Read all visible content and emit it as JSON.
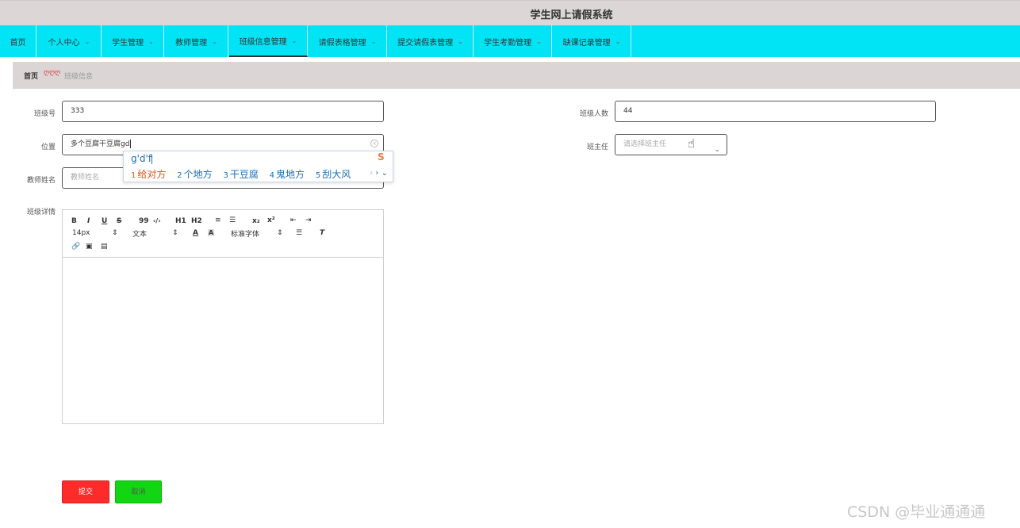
{
  "app": {
    "title": "学生网上请假系统"
  },
  "nav": {
    "items": [
      {
        "label": "首页"
      },
      {
        "label": "个人中心"
      },
      {
        "label": "学生管理"
      },
      {
        "label": "教师管理"
      },
      {
        "label": "班级信息管理"
      },
      {
        "label": "请假表格管理"
      },
      {
        "label": "提交请假表管理"
      },
      {
        "label": "学生考勤管理"
      },
      {
        "label": "缺课记录管理"
      }
    ],
    "active_index": 4,
    "chevron": "⌄"
  },
  "breadcrumb": {
    "home": "首页",
    "separator": "ღღღ",
    "current": "班级信息"
  },
  "form": {
    "class_no": {
      "label": "班级号",
      "value": "333"
    },
    "class_size": {
      "label": "班级人数",
      "value": "44"
    },
    "location": {
      "label": "位置",
      "value": "多个豆腐干豆腐gd"
    },
    "head_teacher": {
      "label": "班主任",
      "placeholder": "请选择班主任"
    },
    "teacher_name": {
      "label": "教师姓名",
      "placeholder": "教师姓名"
    },
    "details": {
      "label": "班级详情"
    }
  },
  "ime": {
    "composition": "g'd'f",
    "candidates": [
      {
        "n": "1",
        "text": "给对方"
      },
      {
        "n": "2",
        "text": "个地方"
      },
      {
        "n": "3",
        "text": "干豆腐"
      },
      {
        "n": "4",
        "text": "鬼地方"
      },
      {
        "n": "5",
        "text": "刮大风"
      }
    ],
    "nav": {
      "prev": "‹",
      "next": "›",
      "expand": "⌄"
    }
  },
  "editor": {
    "toolbar_row1": [
      "B",
      "I",
      "U",
      "S",
      "99",
      "‹/›",
      "H1",
      "H2",
      "≡",
      "☰",
      "x₂",
      "x²",
      "⇤",
      "⇥"
    ],
    "font_size": "14px",
    "text_style": "文本",
    "font_family": "标准字体",
    "updown": "⇕"
  },
  "buttons": {
    "submit": "提交",
    "cancel": "取消"
  },
  "watermark": "CSDN @毕业通通通",
  "colors": {
    "navbar": "#00e4f5",
    "submit": "#ff2a2a",
    "cancel": "#11d611",
    "titlebar": "#ddd6d6"
  }
}
